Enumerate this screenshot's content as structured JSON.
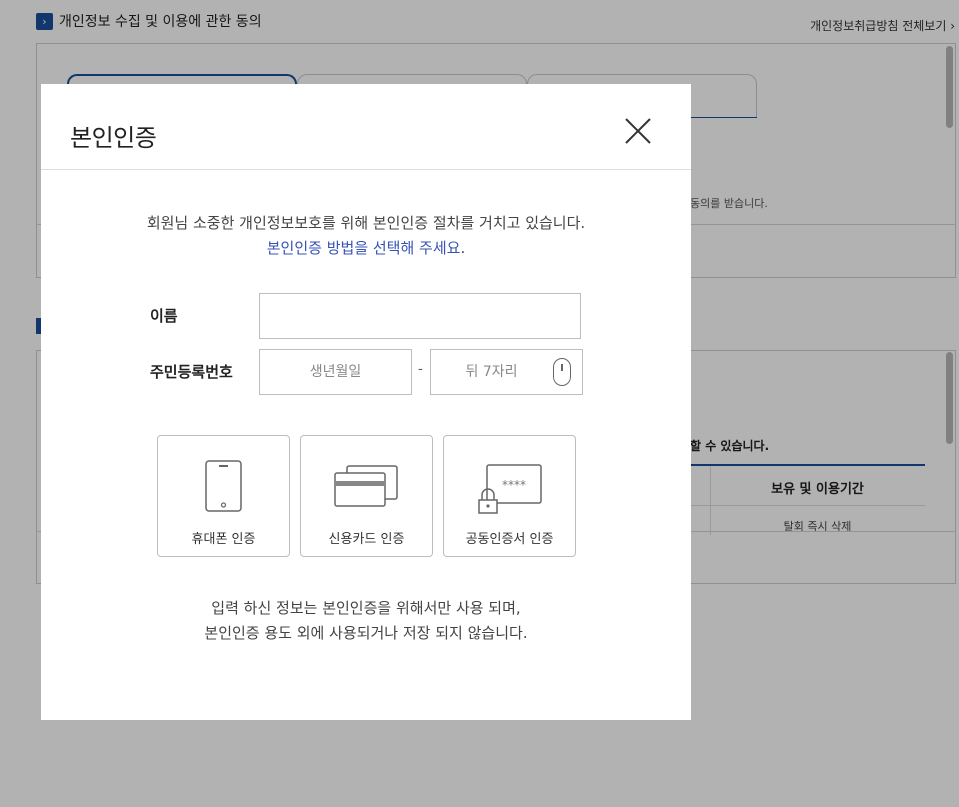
{
  "background": {
    "section1_title": "개인정보 수집 및 이용에 관한 동의",
    "policy_link": "개인정보취급방침 전체보기",
    "consent_text": "동의를 받습니다.",
    "retention_text": "할 수 있습니다.",
    "table_header": "보유 및 이용기간",
    "table_cell": "탈회 즉시 삭제"
  },
  "modal": {
    "title": "본인인증",
    "intro_line1": "회원님 소중한 개인정보보호를 위해 본인인증 절차를 거치고 있습니다.",
    "intro_emphasis": "본인인증 방법을 선택해 주세요",
    "intro_period": ".",
    "name_label": "이름",
    "name_value": "",
    "rrn_label": "주민등록번호",
    "birth_placeholder": "생년월일",
    "dash": "-",
    "back_placeholder": "뒤 7자리",
    "methods": [
      {
        "label": "휴대폰 인증",
        "icon": "mobile-phone-icon"
      },
      {
        "label": "신용카드 인증",
        "icon": "credit-card-icon"
      },
      {
        "label": "공동인증서 인증",
        "icon": "certificate-lock-icon"
      }
    ],
    "cert_mask": "****",
    "notice_line1": "입력 하신 정보는 본인인증을 위해서만 사용 되며,",
    "notice_line2": "본인인증 용도 외에 사용되거나 저장 되지 않습니다."
  },
  "colors": {
    "accent": "#1b4f9c",
    "emphasis": "#3653b5",
    "overlay": "rgba(0,0,0,0.30)"
  }
}
